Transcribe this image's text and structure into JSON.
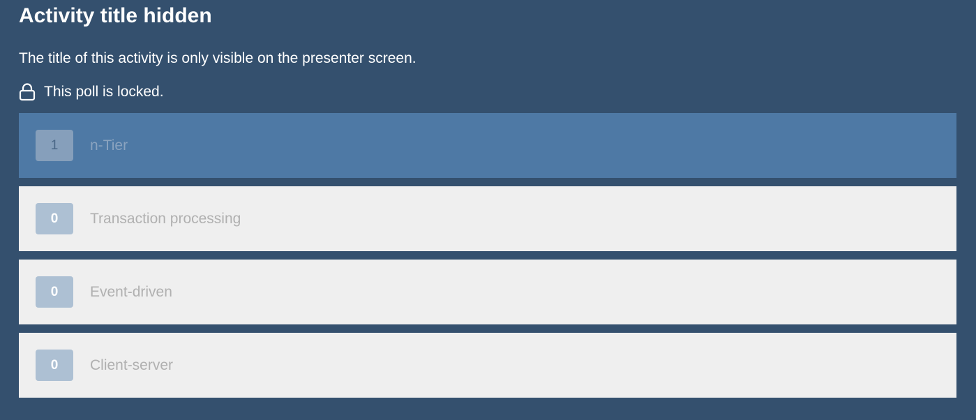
{
  "activity": {
    "title": "Activity title hidden",
    "subtitle": "The title of this activity is only visible on the presenter screen.",
    "locked_text": "This poll is locked."
  },
  "icons": {
    "lock": "lock-icon"
  },
  "colors": {
    "background": "#34506e",
    "selected_option": "#4e79a5",
    "option": "#efefef",
    "count_badge": "#adc0d3"
  },
  "options": [
    {
      "count": "1",
      "label": "n-Tier",
      "selected": true
    },
    {
      "count": "0",
      "label": "Transaction processing",
      "selected": false
    },
    {
      "count": "0",
      "label": "Event-driven",
      "selected": false
    },
    {
      "count": "0",
      "label": "Client-server",
      "selected": false
    }
  ]
}
